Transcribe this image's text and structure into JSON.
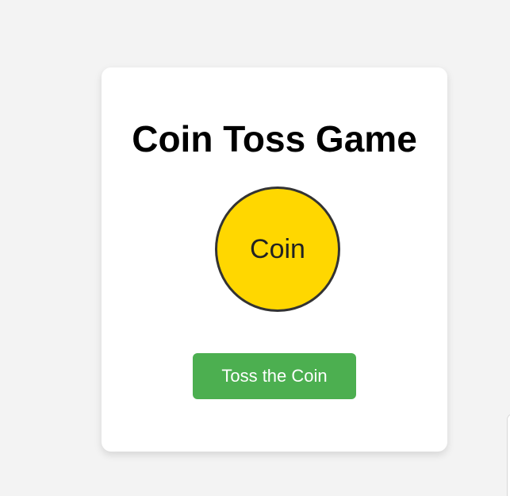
{
  "game": {
    "title": "Coin Toss Game",
    "coin_label": "Coin",
    "toss_button_label": "Toss the Coin"
  },
  "colors": {
    "background": "#f3f3f3",
    "card": "#ffffff",
    "coin_fill": "#ffd700",
    "coin_border": "#333333",
    "button": "#4caf50",
    "button_text": "#ffffff"
  }
}
